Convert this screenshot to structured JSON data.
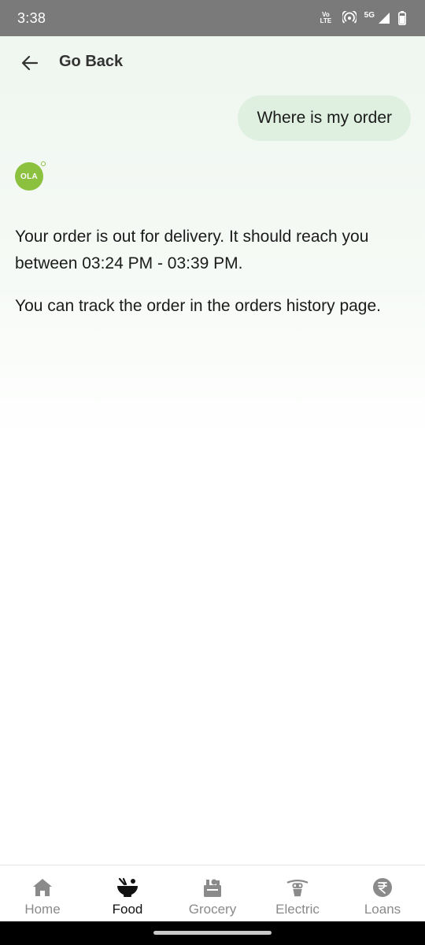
{
  "status_bar": {
    "time": "3:38",
    "volte_top": "Vo",
    "volte_bottom": "LTE",
    "network": "5G"
  },
  "header": {
    "back_label": "Go Back"
  },
  "chat": {
    "user_message": "Where is my order",
    "bot_logo_text": "OLA",
    "bot_paragraphs": [
      "Your order is out for delivery. It should reach you between 03:24 PM - 03:39 PM.",
      "You can track the order in the orders history page."
    ]
  },
  "bottom_nav": {
    "items": [
      {
        "label": "Home",
        "icon": "home-icon",
        "active": false
      },
      {
        "label": "Food",
        "icon": "food-bowl-icon",
        "active": true
      },
      {
        "label": "Grocery",
        "icon": "grocery-bag-icon",
        "active": false
      },
      {
        "label": "Electric",
        "icon": "electric-scooter-icon",
        "active": false
      },
      {
        "label": "Loans",
        "icon": "rupee-icon",
        "active": false
      }
    ]
  },
  "colors": {
    "status_bar": "#7a7a7a",
    "user_bubble": "#dff0e1",
    "ola_green": "#8cc13f",
    "nav_inactive": "#8a8a8a",
    "nav_active": "#111111"
  }
}
